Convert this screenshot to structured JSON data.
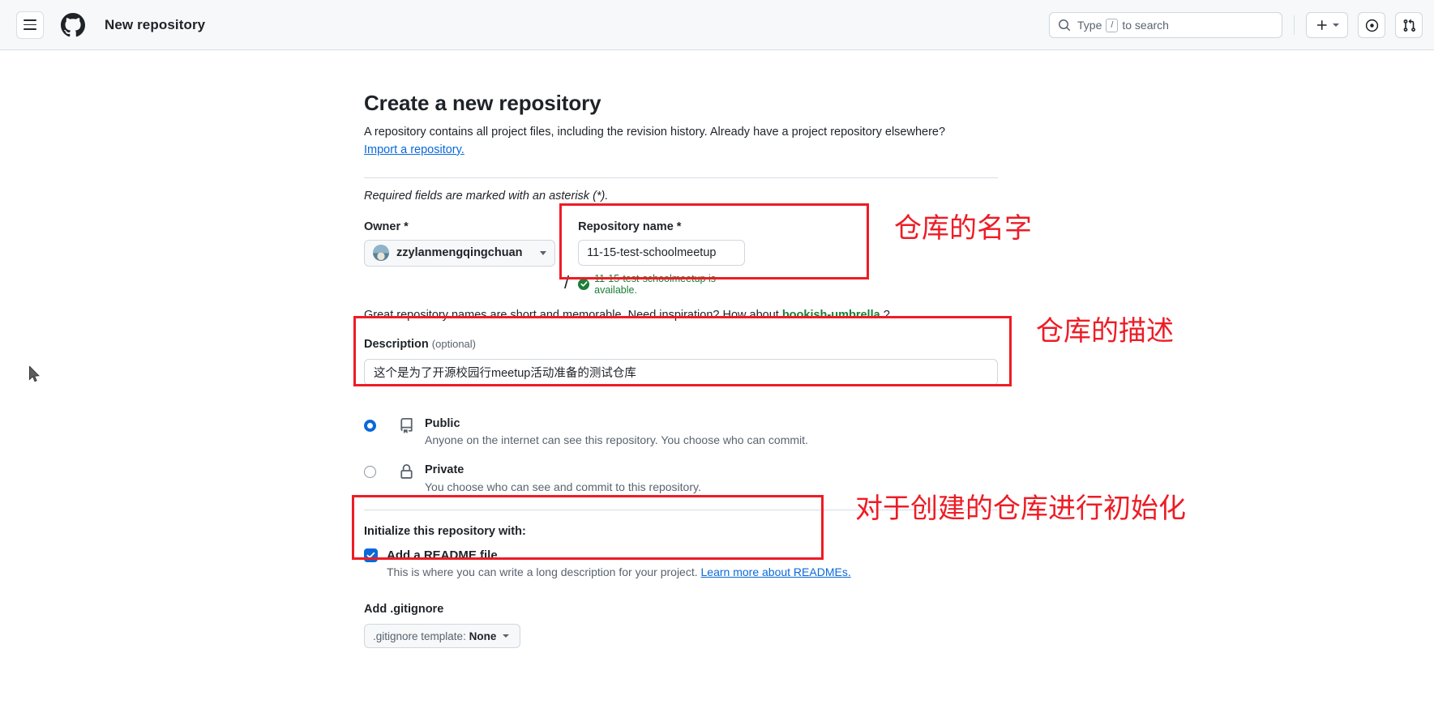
{
  "header": {
    "menu_icon": "hamburger-icon",
    "logo_icon": "github-logo-icon",
    "title": "New repository",
    "search": {
      "placeholder_prefix": "Type",
      "slash_key": "/",
      "placeholder_suffix": "to search",
      "icon": "search-icon"
    },
    "create_new_label": "+",
    "issues_icon": "issue-opened-icon",
    "pull_requests_icon": "git-pull-request-icon"
  },
  "form": {
    "title": "Create a new repository",
    "subtitle": "A repository contains all project files, including the revision history. Already have a project repository elsewhere?",
    "import_link": "Import a repository.",
    "required_note": "Required fields are marked with an asterisk (*).",
    "owner_label": "Owner *",
    "owner_value": "zzylanmengqingchuan",
    "separator": "/",
    "repo_name_label": "Repository name *",
    "repo_name_value": "11-15-test-schoolmeetup",
    "availability": "11-15-test-schoolmeetup is available.",
    "hint_prefix": "Great repository names are short and memorable. Need inspiration? How about",
    "hint_suggestion": "bookish-umbrella",
    "hint_suffix": "?",
    "description_label": "Description",
    "description_optional": "(optional)",
    "description_value": "这个是为了开源校园行meetup活动准备的测试仓库",
    "visibility": [
      {
        "id": "public",
        "icon": "repo-icon",
        "title": "Public",
        "desc": "Anyone on the internet can see this repository. You choose who can commit.",
        "selected": true
      },
      {
        "id": "private",
        "icon": "lock-icon",
        "title": "Private",
        "desc": "You choose who can see and commit to this repository.",
        "selected": false
      }
    ],
    "init_label": "Initialize this repository with:",
    "readme_label": "Add a README file",
    "readme_checked": true,
    "readme_desc": "This is where you can write a long description for your project.",
    "readme_link": "Learn more about READMEs.",
    "gitignore_label": "Add .gitignore",
    "gitignore_prefix": ".gitignore template:",
    "gitignore_value": "None"
  },
  "annotations": {
    "color": "#ee1c25",
    "repo_name": "仓库的名字",
    "description": "仓库的描述",
    "initialize": "对于创建的仓库进行初始化"
  }
}
